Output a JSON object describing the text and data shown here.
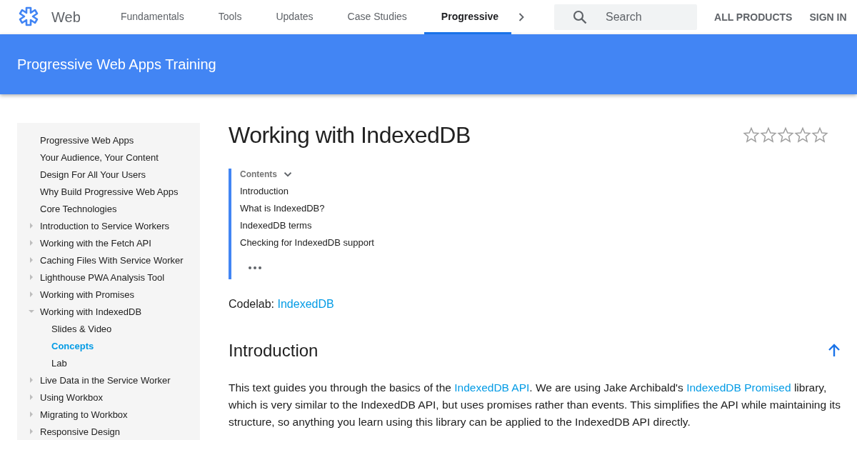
{
  "header": {
    "product": "Web",
    "tabs": [
      {
        "label": "Fundamentals",
        "selected": false
      },
      {
        "label": "Tools",
        "selected": false
      },
      {
        "label": "Updates",
        "selected": false
      },
      {
        "label": "Case Studies",
        "selected": false
      },
      {
        "label": "Progressive",
        "selected": true
      }
    ],
    "search": {
      "placeholder": "Search"
    },
    "links": [
      "ALL PRODUCTS",
      "SIGN IN"
    ]
  },
  "banner": {
    "title": "Progressive Web Apps Training"
  },
  "sidebar": {
    "items": [
      {
        "label": "Progressive Web Apps",
        "kind": "page",
        "selected": false
      },
      {
        "label": "Your Audience, Your Content",
        "kind": "page",
        "selected": false
      },
      {
        "label": "Design For All Your Users",
        "kind": "page",
        "selected": false
      },
      {
        "label": "Why Build Progressive Web Apps",
        "kind": "page",
        "selected": false
      },
      {
        "label": "Core Technologies",
        "kind": "page",
        "selected": false
      },
      {
        "label": "Introduction to Service Workers",
        "kind": "section",
        "expanded": false,
        "selected": false
      },
      {
        "label": "Working with the Fetch API",
        "kind": "section",
        "expanded": false,
        "selected": false
      },
      {
        "label": "Caching Files With Service Worker",
        "kind": "section",
        "expanded": false,
        "selected": false
      },
      {
        "label": "Lighthouse PWA Analysis Tool",
        "kind": "section",
        "expanded": false,
        "selected": false
      },
      {
        "label": "Working with Promises",
        "kind": "section",
        "expanded": false,
        "selected": false
      },
      {
        "label": "Working with IndexedDB",
        "kind": "section",
        "expanded": true,
        "selected": false,
        "children": [
          {
            "label": "Slides & Video",
            "kind": "page",
            "selected": false
          },
          {
            "label": "Concepts",
            "kind": "page",
            "selected": true
          },
          {
            "label": "Lab",
            "kind": "page",
            "selected": false
          }
        ]
      },
      {
        "label": "Live Data in the Service Worker",
        "kind": "section",
        "expanded": false,
        "selected": false
      },
      {
        "label": "Using Workbox",
        "kind": "section",
        "expanded": false,
        "selected": false
      },
      {
        "label": "Migrating to Workbox",
        "kind": "section",
        "expanded": false,
        "selected": false
      },
      {
        "label": "Responsive Design",
        "kind": "section",
        "expanded": false,
        "selected": false
      }
    ]
  },
  "article": {
    "title": "Working with IndexedDB",
    "stars": 0,
    "contents": {
      "heading": "Contents",
      "items": [
        "Introduction",
        "What is IndexedDB?",
        "IndexedDB terms",
        "Checking for IndexedDB support"
      ]
    },
    "codelab": [
      {
        "kind": "text",
        "text": "Codelab: "
      },
      {
        "kind": "link",
        "text": "IndexedDB"
      }
    ],
    "section_title": "Introduction",
    "paragraph": [
      {
        "kind": "text",
        "text": "This text guides you through the basics of the "
      },
      {
        "kind": "link",
        "text": "IndexedDB API"
      },
      {
        "kind": "text",
        "text": ". We are using Jake Archibald's "
      },
      {
        "kind": "link",
        "text": "IndexedDB Promised"
      },
      {
        "kind": "text",
        "text": " library, which is very similar to the IndexedDB API, but uses promises rather than events. This simplifies the API while maintaining its structure, so anything you learn using this library can be applied to the IndexedDB API directly."
      }
    ]
  }
}
